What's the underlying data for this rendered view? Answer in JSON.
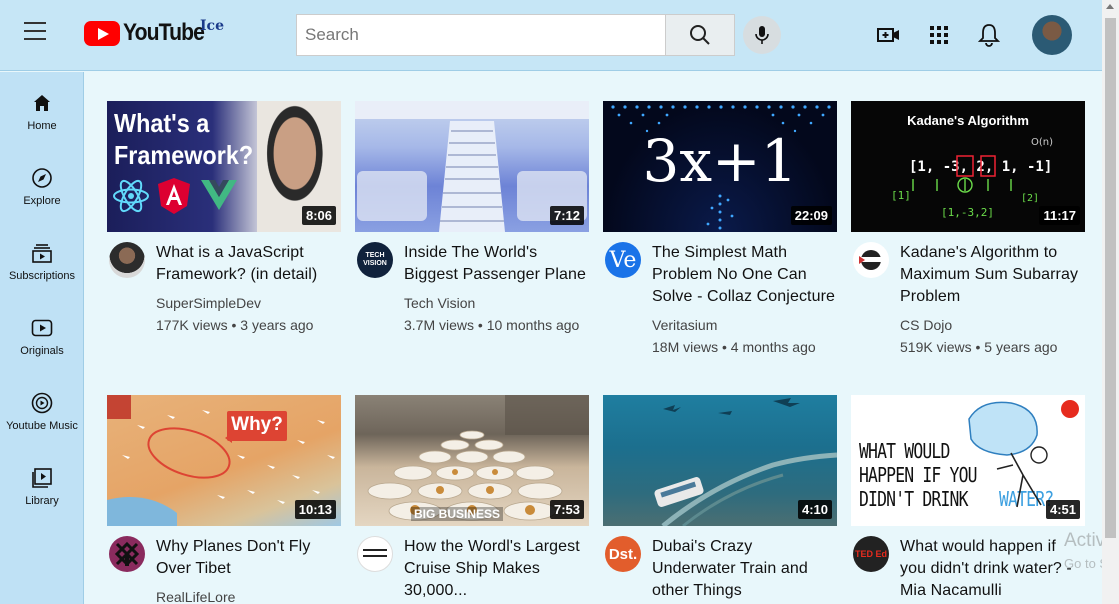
{
  "header": {
    "logo_text": "YouTube",
    "logo_suffix": "Ice",
    "search_placeholder": "Search"
  },
  "sidebar": {
    "items": [
      {
        "label": "Home",
        "icon": "home-icon"
      },
      {
        "label": "Explore",
        "icon": "compass-icon"
      },
      {
        "label": "Subscriptions",
        "icon": "subscriptions-icon"
      },
      {
        "label": "Originals",
        "icon": "originals-icon"
      },
      {
        "label": "Youtube Music",
        "icon": "music-icon"
      },
      {
        "label": "Library",
        "icon": "library-icon"
      }
    ]
  },
  "videos": [
    {
      "title_1": "What is a JavaScript",
      "title_2": "Framework? (in detail)",
      "title_3": "",
      "channel": "SuperSimpleDev",
      "stats": "177K views • 3 years ago",
      "duration": "8:06",
      "thumb_line_1": "What's a",
      "thumb_line_2": "Framework?"
    },
    {
      "title_1": "Inside The World's",
      "title_2": "Biggest Passenger Plane",
      "title_3": "",
      "channel": "Tech Vision",
      "stats": "3.7M views • 10 months ago",
      "duration": "7:12",
      "avatar_text": "TECH VISION"
    },
    {
      "title_1": "The Simplest Math",
      "title_2": "Problem No One Can",
      "title_3": "Solve - Collaz Conjecture",
      "channel": "Veritasium",
      "stats": "18M views • 4 months ago",
      "duration": "22:09",
      "thumb_text": "3x+1",
      "avatar_text": "Ve"
    },
    {
      "title_1": "Kadane's Algorithm to",
      "title_2": "Maximum Sum Subarray",
      "title_3": "Problem",
      "channel": "CS Dojo",
      "stats": "519K views • 5 years ago",
      "duration": "11:17",
      "thumb_text": "Kadane's Algorithm"
    },
    {
      "title_1": "Why Planes Don't Fly",
      "title_2": "Over Tibet",
      "title_3": "",
      "channel": "RealLifeLore",
      "stats": "",
      "duration": "10:13",
      "thumb_text": "Why?"
    },
    {
      "title_1": "How the Wordl's Largest",
      "title_2": "Cruise Ship Makes",
      "title_3": "30,000...",
      "channel": "",
      "stats": "",
      "duration": "7:53",
      "thumb_text": "BIG BUSINESS"
    },
    {
      "title_1": "Dubai's Crazy",
      "title_2": "Underwater Train and",
      "title_3": "other Things",
      "channel": "",
      "stats": "",
      "duration": "4:10",
      "avatar_text": "Dst."
    },
    {
      "title_1": "What would happen if",
      "title_2": "you didn't drink water? -",
      "title_3": "Mia Nacamulli",
      "channel": "",
      "stats": "",
      "duration": "4:51",
      "thumb_line_1": "WHAT WOULD",
      "thumb_line_2": "HAPPEN IF YOU",
      "thumb_line_3": "DIDN'T DRINK",
      "thumb_line_4": "WATER?",
      "avatar_text": "TED Ed"
    }
  ],
  "watermark": {
    "line_1": "Activa",
    "line_2": "Go to Se"
  },
  "colors": {
    "header_bg": "#c6e6f6",
    "sidebar_bg": "#bfe1f5",
    "content_bg": "#e8f7fb",
    "logo_red": "#ff0000"
  }
}
